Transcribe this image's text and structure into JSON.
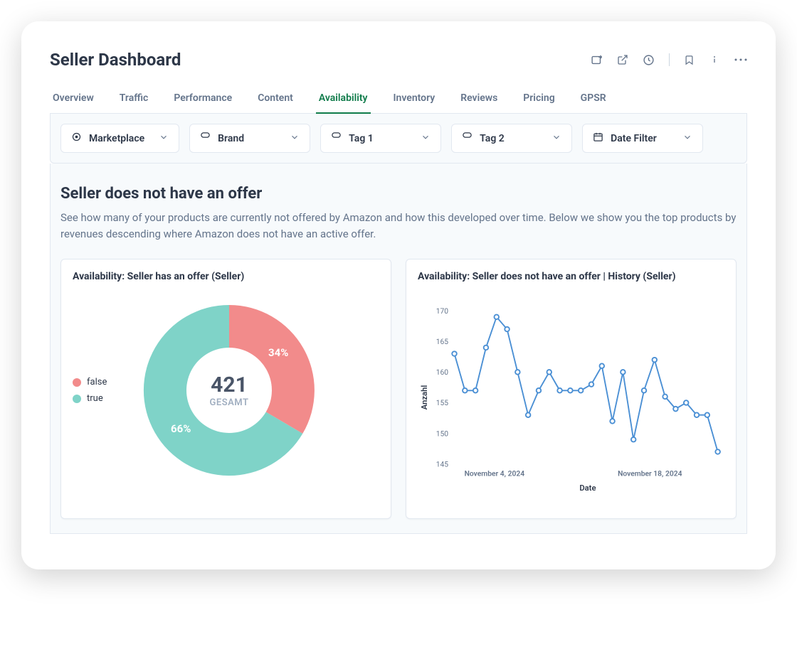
{
  "header": {
    "title": "Seller Dashboard"
  },
  "tabs": [
    {
      "label": "Overview",
      "active": false
    },
    {
      "label": "Traffic",
      "active": false
    },
    {
      "label": "Performance",
      "active": false
    },
    {
      "label": "Content",
      "active": false
    },
    {
      "label": "Availability",
      "active": true
    },
    {
      "label": "Inventory",
      "active": false
    },
    {
      "label": "Reviews",
      "active": false
    },
    {
      "label": "Pricing",
      "active": false
    },
    {
      "label": "GPSR",
      "active": false
    }
  ],
  "filters": {
    "marketplace": "Marketplace",
    "brand": "Brand",
    "tag1": "Tag 1",
    "tag2": "Tag 2",
    "date": "Date Filter"
  },
  "section": {
    "title": "Seller does not have an offer",
    "description": "See how many of your products are currently not offered by Amazon and how this developed over time. Below we show you the top products by revenues descending where Amazon does not have an active offer."
  },
  "donut": {
    "title": "Availability: Seller has an offer (Seller)",
    "legend_false": "false",
    "legend_true": "true",
    "total": "421",
    "total_label": "GESAMT",
    "pct_false": "34%",
    "pct_true": "66%"
  },
  "line": {
    "title": "Availability: Seller does not have an offer | History (Seller)",
    "ylabel": "Anzahl",
    "xlabel": "Date",
    "xtick1": "November 4, 2024",
    "xtick2": "November 18, 2024"
  },
  "chart_data": [
    {
      "type": "pie",
      "title": "Availability: Seller has an offer (Seller)",
      "series": [
        {
          "name": "false",
          "value": 143,
          "percent": 34,
          "color": "#f28b8b"
        },
        {
          "name": "true",
          "value": 278,
          "percent": 66,
          "color": "#7fd3c8"
        }
      ],
      "total": 421,
      "total_label": "GESAMT"
    },
    {
      "type": "line",
      "title": "Availability: Seller does not have an offer | History (Seller)",
      "ylabel": "Anzahl",
      "xlabel": "Date",
      "ylim": [
        145,
        170
      ],
      "yticks": [
        145,
        150,
        155,
        160,
        165,
        170
      ],
      "xticks": [
        "November 4, 2024",
        "November 18, 2024"
      ],
      "x": [
        0,
        1,
        2,
        3,
        4,
        5,
        6,
        7,
        8,
        9,
        10,
        11,
        12,
        13,
        14,
        15,
        16,
        17,
        18,
        19,
        20,
        21,
        22,
        23,
        24,
        25
      ],
      "values": [
        163,
        157,
        157,
        164,
        169,
        167,
        160,
        153,
        157,
        160,
        157,
        157,
        157,
        158,
        161,
        152,
        160,
        149,
        157,
        162,
        156,
        154,
        155,
        153,
        153,
        147
      ],
      "color": "#4a8fd4"
    }
  ]
}
